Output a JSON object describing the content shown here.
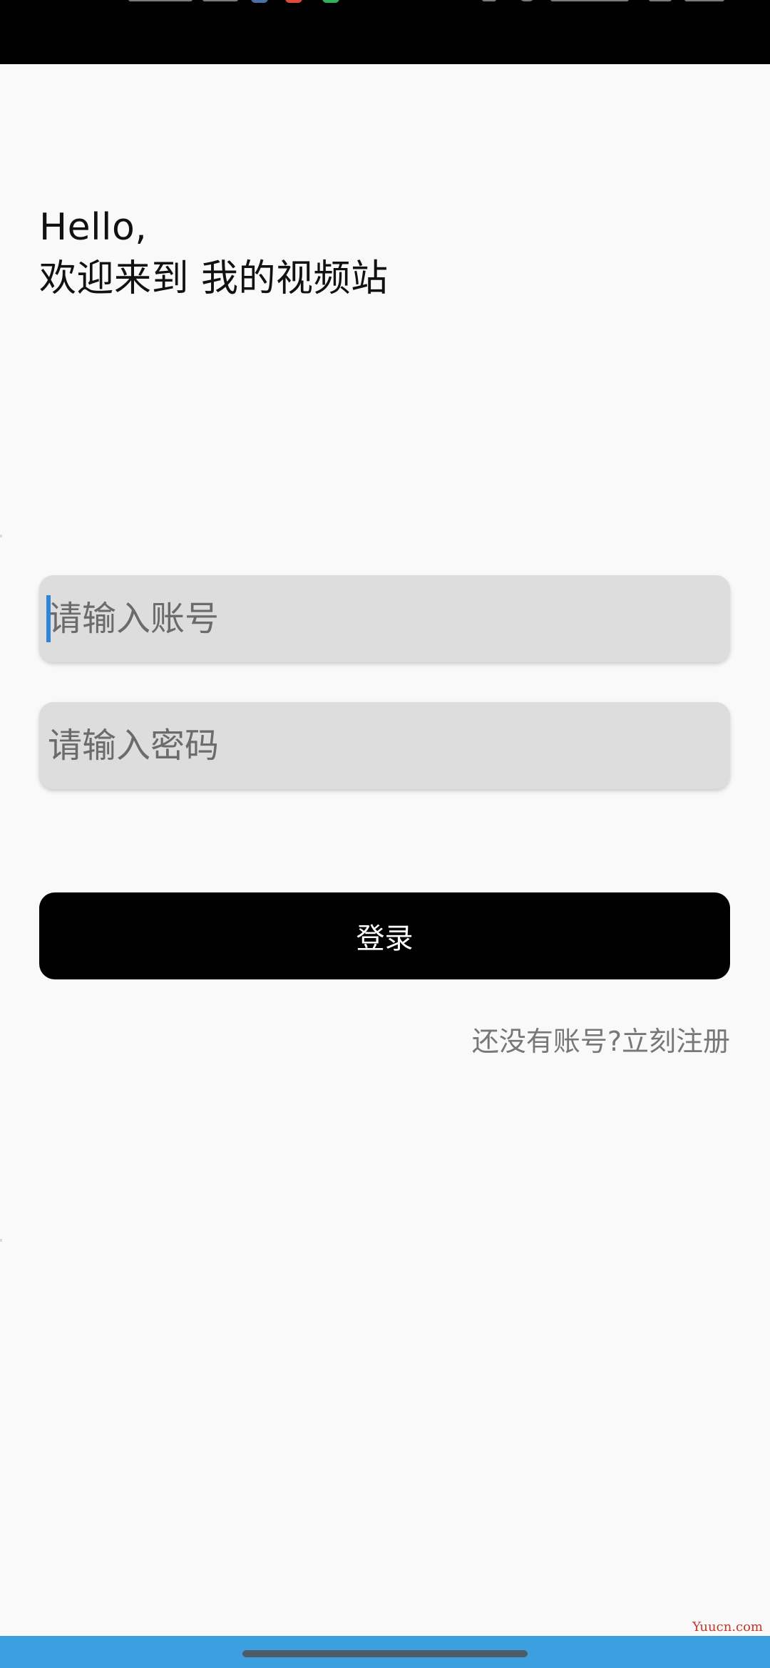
{
  "greeting": {
    "line1": "Hello,",
    "line2": "欢迎来到 我的视频站"
  },
  "form": {
    "account_placeholder": "请输入账号",
    "password_placeholder": "请输入密码",
    "login_label": "登录",
    "register_link": "还没有账号?立刻注册"
  },
  "watermark": "Yuucn.com",
  "colors": {
    "background": "#f9f9f9",
    "field_background": "#dddddd",
    "button_background": "#000000",
    "button_text": "#ffffff",
    "link_text": "#777777",
    "nav_bar": "#3b9fe0",
    "caret": "#2f86d8"
  }
}
